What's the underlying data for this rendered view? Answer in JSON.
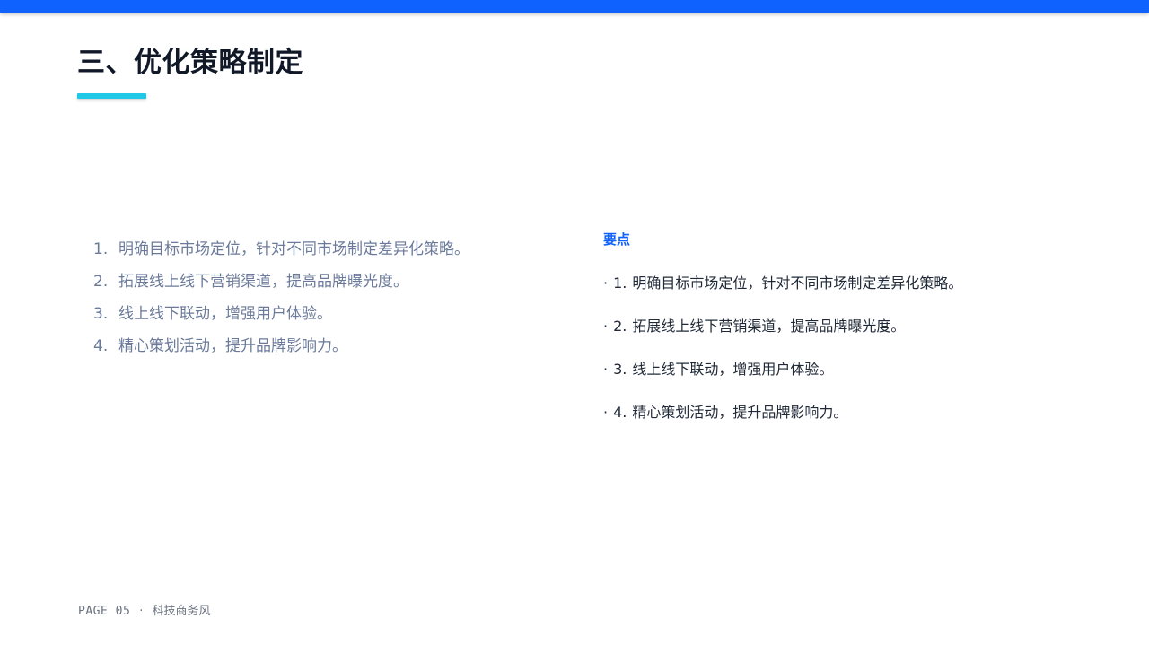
{
  "slide": {
    "title": "三、优化策略制定",
    "accent_color": "#0f62fe",
    "underline_color": "#1ec8e6"
  },
  "left_list": [
    {
      "num": "1.",
      "text": "明确目标市场定位，针对不同市场制定差异化策略。"
    },
    {
      "num": "2.",
      "text": "拓展线上线下营销渠道，提高品牌曝光度。"
    },
    {
      "num": "3.",
      "text": "线上线下联动，增强用户体验。"
    },
    {
      "num": "4.",
      "text": "精心策划活动，提升品牌影响力。"
    }
  ],
  "points": {
    "heading": "要点",
    "bullet": "·",
    "items": [
      {
        "num": "1.",
        "text": "明确目标市场定位，针对不同市场制定差异化策略。"
      },
      {
        "num": "2.",
        "text": "拓展线上线下营销渠道，提高品牌曝光度。"
      },
      {
        "num": "3.",
        "text": "线上线下联动，增强用户体验。"
      },
      {
        "num": "4.",
        "text": "精心策划活动，提升品牌影响力。"
      }
    ]
  },
  "footer": {
    "page": "PAGE 05",
    "separator": "·",
    "style_label": "科技商务风"
  }
}
